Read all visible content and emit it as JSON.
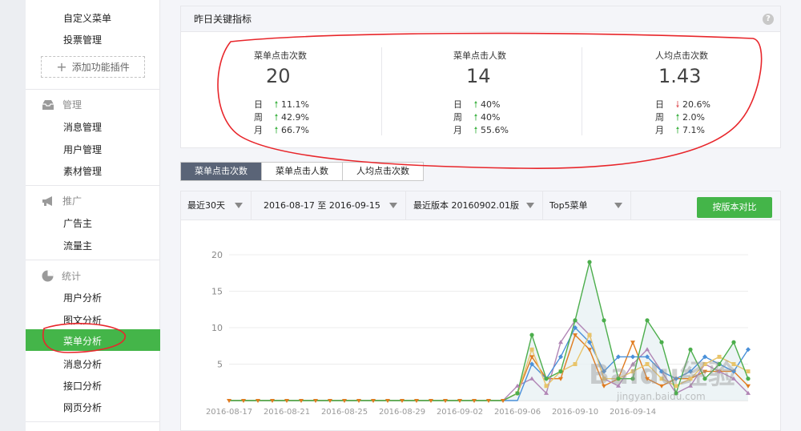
{
  "sidebar": {
    "top_items": [
      "自定义菜单",
      "投票管理"
    ],
    "add_plugin": "添加功能插件",
    "sections": [
      {
        "title": "管理",
        "icon": "inbox-icon",
        "items": [
          "消息管理",
          "用户管理",
          "素材管理"
        ]
      },
      {
        "title": "推广",
        "icon": "megaphone-icon",
        "items": [
          "广告主",
          "流量主"
        ]
      },
      {
        "title": "统计",
        "icon": "pie-chart-icon",
        "items": [
          "用户分析",
          "图文分析",
          "菜单分析",
          "消息分析",
          "接口分析",
          "网页分析"
        ]
      }
    ],
    "active_item": "菜单分析"
  },
  "key_metrics": {
    "title": "昨日关键指标",
    "help": "?",
    "metrics": [
      {
        "title": "菜单点击次数",
        "value": "20",
        "rows": [
          {
            "label": "日",
            "trend": "up",
            "pct": "11.1%"
          },
          {
            "label": "周",
            "trend": "up",
            "pct": "42.9%"
          },
          {
            "label": "月",
            "trend": "up",
            "pct": "66.7%"
          }
        ]
      },
      {
        "title": "菜单点击人数",
        "value": "14",
        "rows": [
          {
            "label": "日",
            "trend": "up",
            "pct": "40%"
          },
          {
            "label": "周",
            "trend": "up",
            "pct": "40%"
          },
          {
            "label": "月",
            "trend": "up",
            "pct": "55.6%"
          }
        ]
      },
      {
        "title": "人均点击次数",
        "value": "1.43",
        "rows": [
          {
            "label": "日",
            "trend": "down",
            "pct": "20.6%"
          },
          {
            "label": "周",
            "trend": "up",
            "pct": "2.0%"
          },
          {
            "label": "月",
            "trend": "up",
            "pct": "7.1%"
          }
        ]
      }
    ]
  },
  "tabs": [
    "菜单点击次数",
    "菜单点击人数",
    "人均点击次数"
  ],
  "active_tab": 0,
  "filters": {
    "range": "最近30天",
    "dates": "2016-08-17 至 2016-09-15",
    "version": "最近版本 20160902.01版",
    "top": "Top5菜单",
    "compare_button": "按版本对比"
  },
  "colors": {
    "green": "#44b549",
    "tab_active": "#5a6477",
    "up": "#44b549",
    "down": "#e15f63",
    "annotation": "#e8262b"
  },
  "watermark": {
    "text": "Baidu经验",
    "sub": "jingyan.baidu.com"
  },
  "chart_data": {
    "type": "line",
    "x_tick_labels": [
      "2016-08-17",
      "2016-08-21",
      "2016-08-25",
      "2016-08-29",
      "2016-09-02",
      "2016-09-06",
      "2016-09-10",
      "2016-09-14"
    ],
    "x_start": "2016-08-17",
    "x_count": 30,
    "ylim": [
      0,
      20
    ],
    "y_ticks": [
      0,
      5,
      10,
      15,
      20
    ],
    "grid": true,
    "series": [
      {
        "color": "#4cae4c",
        "marker": "circle",
        "fill": "#e8f1f4",
        "values": [
          0,
          0,
          0,
          0,
          0,
          0,
          0,
          0,
          0,
          0,
          0,
          0,
          0,
          0,
          0,
          0,
          0,
          0,
          0,
          0,
          1,
          9,
          3,
          4,
          11,
          19,
          11,
          3,
          3,
          11,
          8,
          1,
          7,
          3,
          5,
          8,
          3
        ]
      },
      {
        "color": "#4a90d9",
        "marker": "diamond",
        "values": [
          0,
          0,
          0,
          0,
          0,
          0,
          0,
          0,
          0,
          0,
          0,
          0,
          0,
          0,
          0,
          0,
          0,
          0,
          0,
          0,
          0,
          5,
          3,
          6,
          10,
          8,
          4,
          6,
          6,
          6,
          4,
          3,
          4,
          6,
          5,
          4,
          7
        ]
      },
      {
        "color": "#b085b5",
        "marker": "triangle",
        "values": [
          0,
          0,
          0,
          0,
          0,
          0,
          0,
          0,
          0,
          0,
          0,
          0,
          0,
          0,
          0,
          0,
          0,
          0,
          0,
          0,
          2,
          3,
          1,
          8,
          11,
          9,
          3,
          2,
          5,
          7,
          4,
          1,
          2,
          5,
          4,
          3,
          1
        ]
      },
      {
        "color": "#e07b1f",
        "marker": "triangle-down",
        "values": [
          0,
          0,
          0,
          0,
          0,
          0,
          0,
          0,
          0,
          0,
          0,
          0,
          0,
          0,
          0,
          0,
          0,
          0,
          0,
          0,
          1,
          6,
          3,
          3,
          9,
          7,
          2,
          3,
          8,
          3,
          2,
          3,
          3,
          4,
          4,
          4,
          2
        ]
      },
      {
        "color": "#e8c46a",
        "marker": "square",
        "values": [
          0,
          0,
          0,
          0,
          0,
          0,
          0,
          0,
          0,
          0,
          0,
          0,
          0,
          0,
          0,
          0,
          0,
          0,
          0,
          0,
          1,
          7,
          2,
          4,
          5,
          9,
          3,
          3,
          4,
          5,
          3,
          2,
          3,
          5,
          6,
          5,
          4
        ]
      }
    ]
  }
}
